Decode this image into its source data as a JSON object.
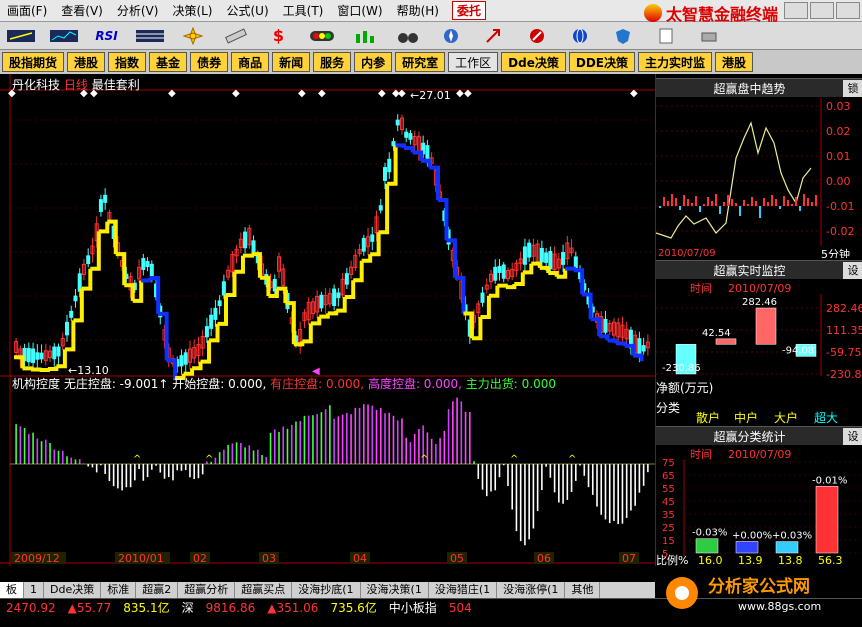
{
  "menubar": {
    "items": [
      "画面(F)",
      "查看(V)",
      "分析(V)",
      "决策(L)",
      "公式(U)",
      "工具(T)",
      "窗口(W)",
      "帮助(H)"
    ],
    "weituo": "委托",
    "brand": "太智慧金融终端"
  },
  "toolbar": {
    "rsi_label": "RSI"
  },
  "categories": [
    "股指期货",
    "港股",
    "指数",
    "基金",
    "债券",
    "商品",
    "新闻",
    "服务",
    "内参",
    "研究室",
    "工作区",
    "Dde决策",
    "DDE决策",
    "主力实时监",
    "港股"
  ],
  "chart": {
    "stock_name": "丹化科技",
    "period": "日线",
    "method": "最佳套利",
    "price_high_label": "27.01",
    "price_low_label": "13.10",
    "indicator_name": "机构控度",
    "indicator_items": [
      {
        "label": "无庄控盘: -9.001↑",
        "color": "#ffffff"
      },
      {
        "label": "开始控盘: 0.000,",
        "color": "#ffffff"
      },
      {
        "label": "有庄控盘: 0.000,",
        "color": "#ff3333"
      },
      {
        "label": "高度控盘: 0.000,",
        "color": "#ff44ff"
      },
      {
        "label": "主力出货: 0.000",
        "color": "#33ff33"
      }
    ],
    "xaxis": [
      "2009/12",
      "2010/01",
      "02",
      "03",
      "04",
      "05",
      "06",
      "07"
    ]
  },
  "chart_data": {
    "type": "candlestick",
    "title": "丹化科技 日线",
    "high_marker": 27.01,
    "low_marker": 13.1,
    "months": [
      "2009/12",
      "2010/01",
      "02",
      "03",
      "04",
      "05",
      "06",
      "07"
    ]
  },
  "right_panel": {
    "trend": {
      "title": "超赢盘中趋势",
      "btn": "锁",
      "yticks": [
        "0.03",
        "0.02",
        "0.01",
        "0.00",
        "-0.01",
        "-0.02"
      ],
      "date": "2010/07/09",
      "period": "5分钟"
    },
    "monitor": {
      "title": "超赢实时监控",
      "btn": "设",
      "time_label": "时间",
      "date": "2010/07/09",
      "values": [
        "-230.86",
        "42.54",
        "282.46",
        "-94.08"
      ],
      "yticks": [
        "282.46",
        "111.35",
        "-59.75",
        "-230.86"
      ],
      "net_label": "净额(万元)",
      "class_label": "分类",
      "classes": [
        "散户",
        "中户",
        "大户",
        "超大"
      ]
    },
    "stats": {
      "title": "超赢分类统计",
      "btn": "设",
      "time_label": "时间",
      "date": "2010/07/09",
      "yticks": [
        "75",
        "65",
        "55",
        "45",
        "35",
        "25",
        "15",
        "5"
      ],
      "pcts": [
        "-0.03%",
        "+0.00%",
        "+0.03%",
        "-0.01%"
      ],
      "ratio_label": "比例%",
      "ratios": [
        "16.0",
        "13.9",
        "13.8",
        "56.3"
      ]
    }
  },
  "tabs": [
    "板",
    "1",
    "Dde决策",
    "标准",
    "超赢2",
    "超赢分析",
    "超赢买点",
    "没海抄底(1",
    "没海决策(1",
    "没海猎庄(1",
    "没海涨停(1",
    "其他"
  ],
  "status": {
    "sh_index": "2470.92",
    "sh_change": "▲55.77",
    "sh_amount": "835.1亿",
    "sz_label": "深",
    "sz_index": "9816.86",
    "sz_change": "▲351.06",
    "sz_amount": "735.6亿",
    "board": "中小板指",
    "extra": "504"
  },
  "watermark": {
    "title": "分析家公式网",
    "url": "www.88gs.com"
  }
}
